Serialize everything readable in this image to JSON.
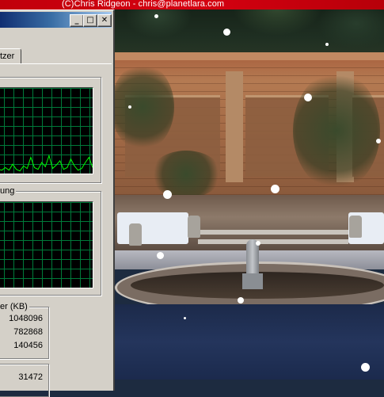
{
  "wallpaper": {
    "credit": "(C)Chris Ridgeon - chris@planetlara.com",
    "accent_color": "#d60011"
  },
  "task_manager": {
    "title_bar_buttons": {
      "minimize": "_",
      "maximize": "□",
      "close": "✕"
    },
    "tab_partial_label": "tzer",
    "cpu_history": {
      "graph_color": "#00ff00",
      "samples": [
        2,
        4,
        3,
        6,
        3,
        10,
        4,
        2,
        8,
        5,
        18,
        6,
        4,
        12,
        7,
        20,
        5,
        9,
        14,
        4,
        6,
        16,
        8,
        3,
        5,
        12,
        18,
        6
      ]
    },
    "memory_history": {
      "partial_label": "ung",
      "graph_color": "#00ff00"
    },
    "commit_charge": {
      "partial_label": "er (KB)",
      "values": [
        "1048096",
        "782868",
        "140456"
      ]
    },
    "bottom_group": {
      "values": [
        "31472"
      ]
    }
  }
}
